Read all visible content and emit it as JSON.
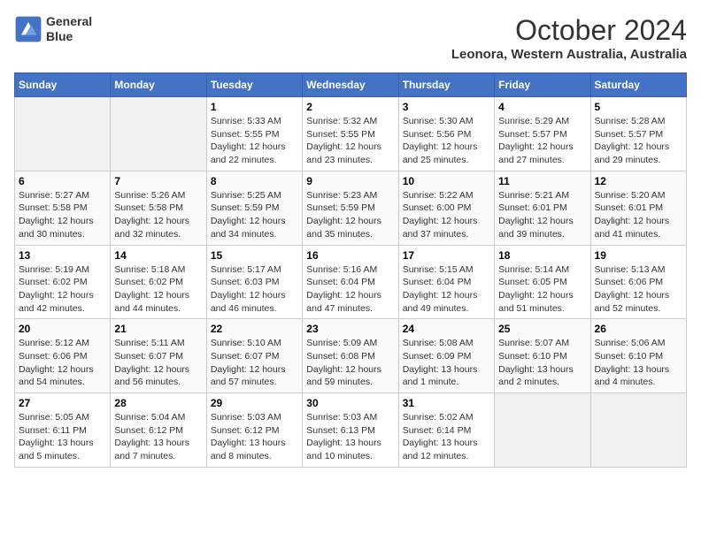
{
  "logo": {
    "line1": "General",
    "line2": "Blue"
  },
  "title": "October 2024",
  "subtitle": "Leonora, Western Australia, Australia",
  "header_days": [
    "Sunday",
    "Monday",
    "Tuesday",
    "Wednesday",
    "Thursday",
    "Friday",
    "Saturday"
  ],
  "weeks": [
    [
      {
        "day": "",
        "sunrise": "",
        "sunset": "",
        "daylight": ""
      },
      {
        "day": "",
        "sunrise": "",
        "sunset": "",
        "daylight": ""
      },
      {
        "day": "1",
        "sunrise": "Sunrise: 5:33 AM",
        "sunset": "Sunset: 5:55 PM",
        "daylight": "Daylight: 12 hours and 22 minutes."
      },
      {
        "day": "2",
        "sunrise": "Sunrise: 5:32 AM",
        "sunset": "Sunset: 5:55 PM",
        "daylight": "Daylight: 12 hours and 23 minutes."
      },
      {
        "day": "3",
        "sunrise": "Sunrise: 5:30 AM",
        "sunset": "Sunset: 5:56 PM",
        "daylight": "Daylight: 12 hours and 25 minutes."
      },
      {
        "day": "4",
        "sunrise": "Sunrise: 5:29 AM",
        "sunset": "Sunset: 5:57 PM",
        "daylight": "Daylight: 12 hours and 27 minutes."
      },
      {
        "day": "5",
        "sunrise": "Sunrise: 5:28 AM",
        "sunset": "Sunset: 5:57 PM",
        "daylight": "Daylight: 12 hours and 29 minutes."
      }
    ],
    [
      {
        "day": "6",
        "sunrise": "Sunrise: 5:27 AM",
        "sunset": "Sunset: 5:58 PM",
        "daylight": "Daylight: 12 hours and 30 minutes."
      },
      {
        "day": "7",
        "sunrise": "Sunrise: 5:26 AM",
        "sunset": "Sunset: 5:58 PM",
        "daylight": "Daylight: 12 hours and 32 minutes."
      },
      {
        "day": "8",
        "sunrise": "Sunrise: 5:25 AM",
        "sunset": "Sunset: 5:59 PM",
        "daylight": "Daylight: 12 hours and 34 minutes."
      },
      {
        "day": "9",
        "sunrise": "Sunrise: 5:23 AM",
        "sunset": "Sunset: 5:59 PM",
        "daylight": "Daylight: 12 hours and 35 minutes."
      },
      {
        "day": "10",
        "sunrise": "Sunrise: 5:22 AM",
        "sunset": "Sunset: 6:00 PM",
        "daylight": "Daylight: 12 hours and 37 minutes."
      },
      {
        "day": "11",
        "sunrise": "Sunrise: 5:21 AM",
        "sunset": "Sunset: 6:01 PM",
        "daylight": "Daylight: 12 hours and 39 minutes."
      },
      {
        "day": "12",
        "sunrise": "Sunrise: 5:20 AM",
        "sunset": "Sunset: 6:01 PM",
        "daylight": "Daylight: 12 hours and 41 minutes."
      }
    ],
    [
      {
        "day": "13",
        "sunrise": "Sunrise: 5:19 AM",
        "sunset": "Sunset: 6:02 PM",
        "daylight": "Daylight: 12 hours and 42 minutes."
      },
      {
        "day": "14",
        "sunrise": "Sunrise: 5:18 AM",
        "sunset": "Sunset: 6:02 PM",
        "daylight": "Daylight: 12 hours and 44 minutes."
      },
      {
        "day": "15",
        "sunrise": "Sunrise: 5:17 AM",
        "sunset": "Sunset: 6:03 PM",
        "daylight": "Daylight: 12 hours and 46 minutes."
      },
      {
        "day": "16",
        "sunrise": "Sunrise: 5:16 AM",
        "sunset": "Sunset: 6:04 PM",
        "daylight": "Daylight: 12 hours and 47 minutes."
      },
      {
        "day": "17",
        "sunrise": "Sunrise: 5:15 AM",
        "sunset": "Sunset: 6:04 PM",
        "daylight": "Daylight: 12 hours and 49 minutes."
      },
      {
        "day": "18",
        "sunrise": "Sunrise: 5:14 AM",
        "sunset": "Sunset: 6:05 PM",
        "daylight": "Daylight: 12 hours and 51 minutes."
      },
      {
        "day": "19",
        "sunrise": "Sunrise: 5:13 AM",
        "sunset": "Sunset: 6:06 PM",
        "daylight": "Daylight: 12 hours and 52 minutes."
      }
    ],
    [
      {
        "day": "20",
        "sunrise": "Sunrise: 5:12 AM",
        "sunset": "Sunset: 6:06 PM",
        "daylight": "Daylight: 12 hours and 54 minutes."
      },
      {
        "day": "21",
        "sunrise": "Sunrise: 5:11 AM",
        "sunset": "Sunset: 6:07 PM",
        "daylight": "Daylight: 12 hours and 56 minutes."
      },
      {
        "day": "22",
        "sunrise": "Sunrise: 5:10 AM",
        "sunset": "Sunset: 6:07 PM",
        "daylight": "Daylight: 12 hours and 57 minutes."
      },
      {
        "day": "23",
        "sunrise": "Sunrise: 5:09 AM",
        "sunset": "Sunset: 6:08 PM",
        "daylight": "Daylight: 12 hours and 59 minutes."
      },
      {
        "day": "24",
        "sunrise": "Sunrise: 5:08 AM",
        "sunset": "Sunset: 6:09 PM",
        "daylight": "Daylight: 13 hours and 1 minute."
      },
      {
        "day": "25",
        "sunrise": "Sunrise: 5:07 AM",
        "sunset": "Sunset: 6:10 PM",
        "daylight": "Daylight: 13 hours and 2 minutes."
      },
      {
        "day": "26",
        "sunrise": "Sunrise: 5:06 AM",
        "sunset": "Sunset: 6:10 PM",
        "daylight": "Daylight: 13 hours and 4 minutes."
      }
    ],
    [
      {
        "day": "27",
        "sunrise": "Sunrise: 5:05 AM",
        "sunset": "Sunset: 6:11 PM",
        "daylight": "Daylight: 13 hours and 5 minutes."
      },
      {
        "day": "28",
        "sunrise": "Sunrise: 5:04 AM",
        "sunset": "Sunset: 6:12 PM",
        "daylight": "Daylight: 13 hours and 7 minutes."
      },
      {
        "day": "29",
        "sunrise": "Sunrise: 5:03 AM",
        "sunset": "Sunset: 6:12 PM",
        "daylight": "Daylight: 13 hours and 8 minutes."
      },
      {
        "day": "30",
        "sunrise": "Sunrise: 5:03 AM",
        "sunset": "Sunset: 6:13 PM",
        "daylight": "Daylight: 13 hours and 10 minutes."
      },
      {
        "day": "31",
        "sunrise": "Sunrise: 5:02 AM",
        "sunset": "Sunset: 6:14 PM",
        "daylight": "Daylight: 13 hours and 12 minutes."
      },
      {
        "day": "",
        "sunrise": "",
        "sunset": "",
        "daylight": ""
      },
      {
        "day": "",
        "sunrise": "",
        "sunset": "",
        "daylight": ""
      }
    ]
  ]
}
